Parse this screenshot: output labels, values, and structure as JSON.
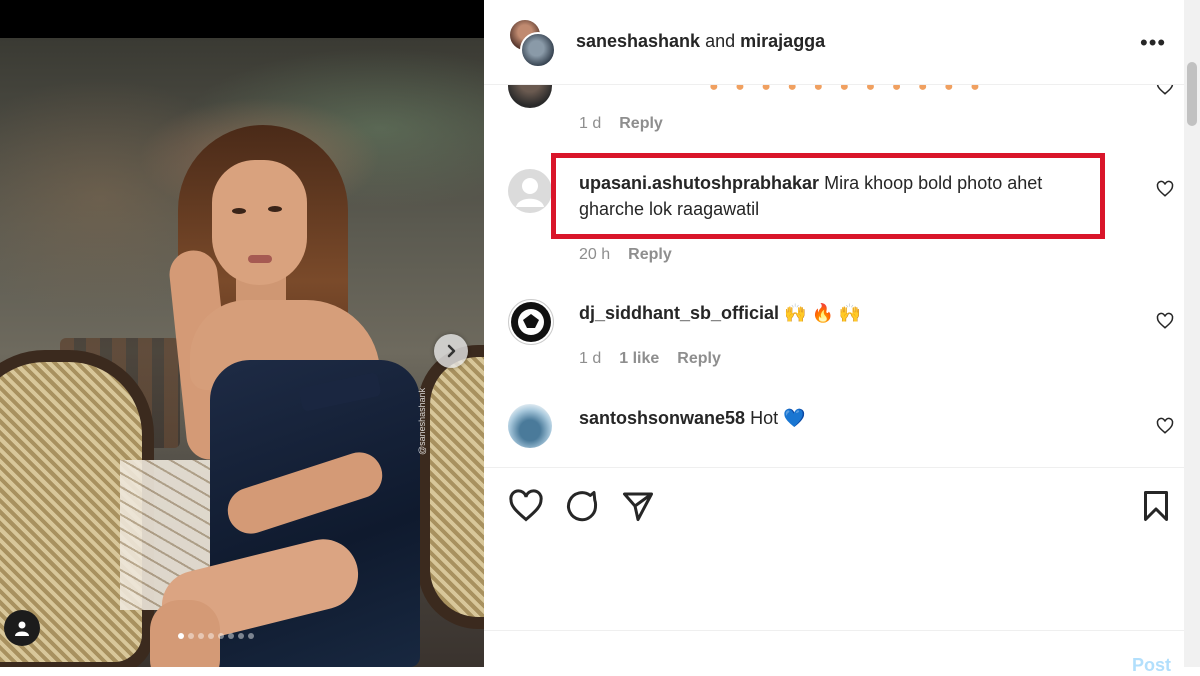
{
  "post": {
    "watermark": "@saneshashank",
    "carousel_dots": 8,
    "active_dot": 0
  },
  "header": {
    "user1": "saneshashank",
    "connector": "and",
    "user2": "mirajagga",
    "more_icon": "more-options-icon"
  },
  "comments": [
    {
      "username": "",
      "text": "",
      "time": "1 d",
      "likes": "",
      "reply_label": "Reply",
      "partial": true
    },
    {
      "username": "upasani.ashutoshprabhakar",
      "text": "Mira khoop bold photo ahet gharche lok raagawatil",
      "time": "20 h",
      "likes": "",
      "reply_label": "Reply",
      "highlighted": true
    },
    {
      "username": "dj_siddhant_sb_official",
      "text": "🙌 🔥 🙌",
      "time": "1 d",
      "likes": "1 like",
      "reply_label": "Reply"
    },
    {
      "username": "santoshsonwane58",
      "text": "Hot 💙",
      "time": "",
      "likes": "",
      "reply_label": ""
    }
  ],
  "actions": {
    "like_icon": "heart-icon",
    "comment_icon": "comment-icon",
    "share_icon": "send-icon",
    "save_icon": "bookmark-icon"
  },
  "composer": {
    "post_label": "Post"
  },
  "colors": {
    "highlight_border": "#d9152a",
    "text": "#262626",
    "meta": "#8e8e8e",
    "post_button": "#b2dffc"
  }
}
